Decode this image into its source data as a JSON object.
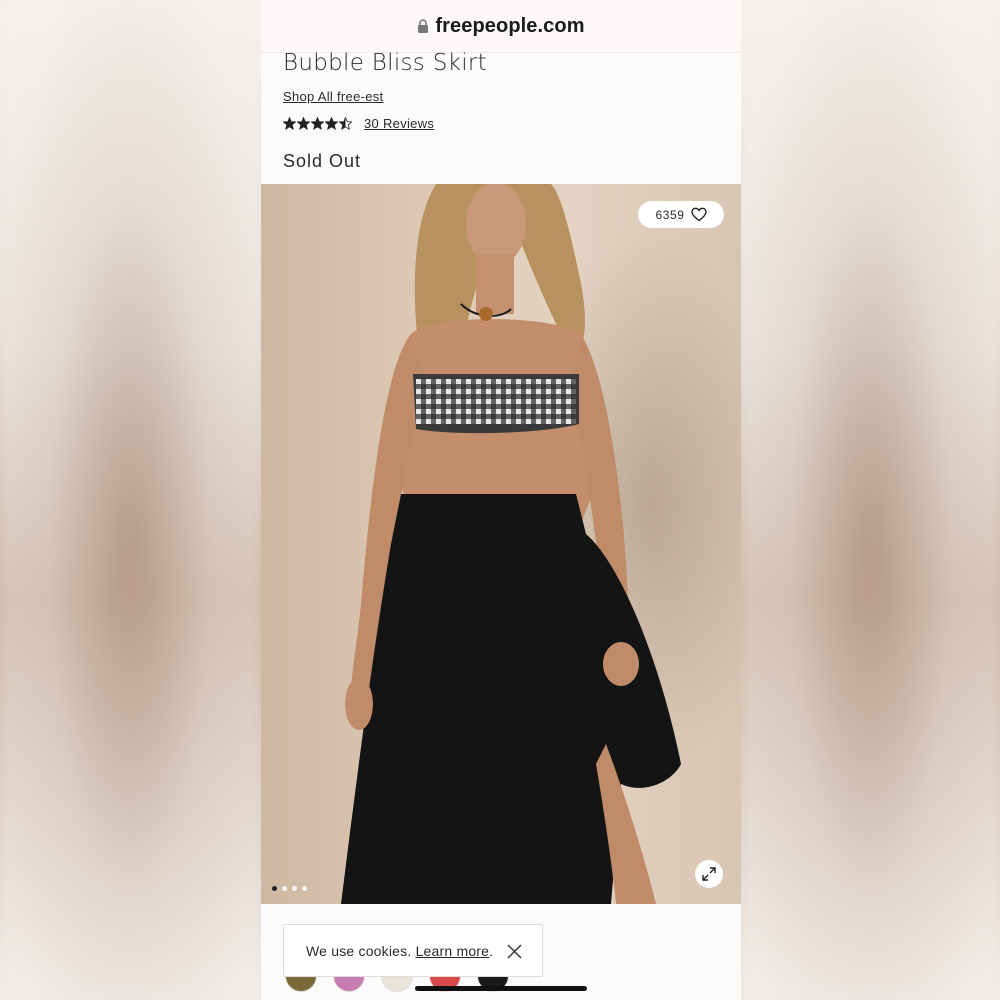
{
  "browser": {
    "url": "freepeople.com",
    "lock_icon": "lock-icon"
  },
  "product": {
    "title": "Bubble Bliss Skirt",
    "shop_link": "Shop All free-est",
    "rating": 4.5,
    "rating_max": 5,
    "reviews_label": "30 Reviews",
    "status": "Sold Out"
  },
  "image": {
    "like_count": "6359",
    "heart_icon": "heart-outline-icon",
    "expand_icon": "expand-icon",
    "carousel_dots": 4,
    "carousel_active_index": 0
  },
  "swatches": [
    {
      "color": "#7a6a3a"
    },
    {
      "color": "#c77bb0"
    },
    {
      "color": "#e8e4d8"
    },
    {
      "color": "#d94a4a"
    },
    {
      "color": "#1a1a1a"
    }
  ],
  "cookie_banner": {
    "text": "We use cookies.",
    "link": "Learn more",
    "suffix": ".",
    "close_icon": "close-icon"
  }
}
